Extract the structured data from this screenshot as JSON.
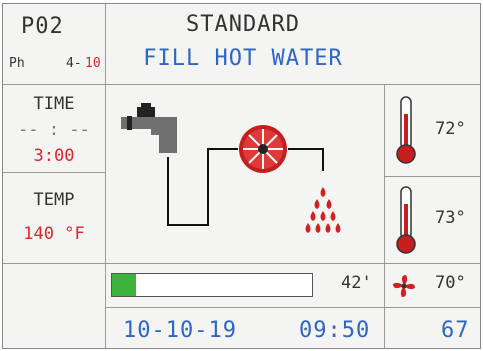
{
  "program": {
    "code": "P02",
    "phase_label": "Ph",
    "phase_current": "4-",
    "phase_total": "10"
  },
  "header": {
    "mode": "STANDARD",
    "step": "FILL HOT WATER"
  },
  "time_panel": {
    "label": "TIME",
    "current": "-- : --",
    "duration": "3:00"
  },
  "temp_panel": {
    "label": "TEMP",
    "value": "140 °F"
  },
  "sensors": {
    "temp1": "72°",
    "temp2": "73°",
    "fan": "70°"
  },
  "progress": {
    "fraction": 0.12,
    "value": "42'"
  },
  "footer": {
    "date": "10-10-19",
    "time": "09:50",
    "number": "67"
  },
  "colors": {
    "red": "#e02727",
    "blue": "#2e66c8",
    "green": "#3cb33c",
    "text": "#333333"
  },
  "icons": [
    "water-tap-icon",
    "pump-wheel-icon",
    "water-drops-icon",
    "thermometer-icon",
    "fan-icon"
  ]
}
